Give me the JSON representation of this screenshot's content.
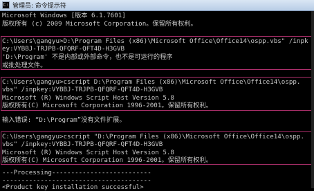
{
  "window": {
    "title": "管理员: 命令提示符"
  },
  "console_lines": [
    "Microsoft Windows [版本 6.1.7601]",
    "版权所有 (c) 2009 Microsoft Corporation。保留所有权利。",
    "C:\\Users\\gangyu>D:\\Program Files (x86)\\Microsoft Office\\Office14\\ospp.vbs\" /inpk",
    "ey:VYBBJ-TRJPB-QFQRF-QFT4D-H3GVB",
    "'D:\\Program' 不是内部或外部命令，也不是可运行的程序",
    "或批处理文件。",
    "C:\\Users\\gangyu>cscript D:\\Program Files (x86)\\Microsoft Office\\Office14\\ospp.",
    "vbs\" /inpkey:VYBBJ-TRJPB-QFQRF-QFT4D-H3GVB",
    "Microsoft (R) Windows Script Host Version 5.8",
    "版权所有(C) Microsoft Corporation 1996-2001。保留所有权利。",
    "输入错误: “D:\\Program”没有文件扩展。",
    "C:\\Users\\gangyu>cscript \"D:\\Program Files (x86)\\Microsoft Office\\Office14\\ospp.",
    "vbs\" /inpkey:VYBBJ-TRJPB-QFQRF-QFT4D-H3GVB",
    "Microsoft (R) Windows Script Host Version 5.8",
    "版权所有(C) Microsoft Corporation 1996-2001。保留所有权利。",
    "---Processing--------------------------",
    "---------------------------------------",
    "<Product key installation successful>"
  ]
}
